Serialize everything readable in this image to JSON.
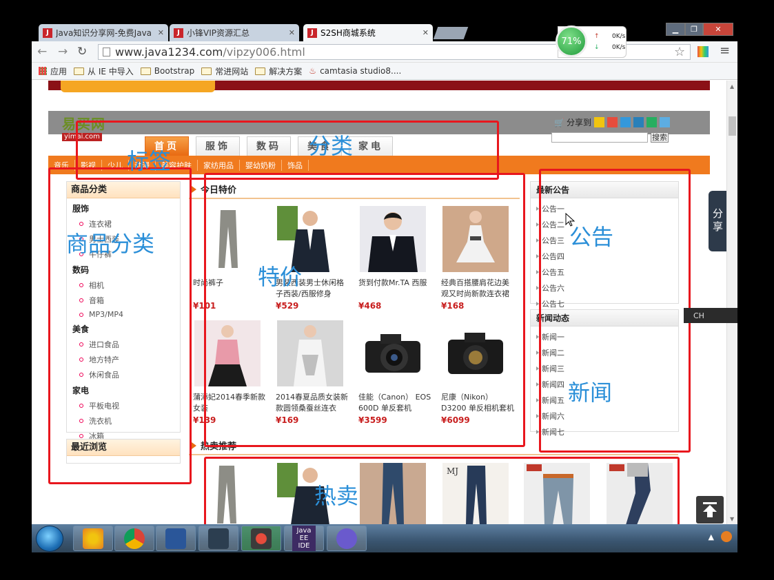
{
  "browser": {
    "tabs": [
      {
        "icon": "J",
        "title": "Java知识分享网-免费Java"
      },
      {
        "icon": "J",
        "title": "小锋VIP资源汇总"
      },
      {
        "icon": "J",
        "title": "S2SH商城系统"
      }
    ],
    "close_glyph": "✕",
    "window_buttons": [
      "▁",
      "❐",
      "✕"
    ],
    "url_host": "www.java1234.com",
    "url_path": "/vipzy006.html",
    "bookmarks": [
      "应用",
      "从 IE 中导入",
      "Bootstrap",
      "常进网站",
      "解决方案",
      "camtasia studio8...."
    ],
    "net_widget": {
      "percent": "71%",
      "up": "0K/s",
      "down": "0K/s"
    }
  },
  "site": {
    "logo_cn": "易买网",
    "logo_en": "yimai.com",
    "share_label": "分享到",
    "search_button": "搜索",
    "nav_tabs": [
      "首页",
      "服饰",
      "数码",
      "美食",
      "家电"
    ],
    "sub_nav": [
      "音乐",
      "影视",
      "少儿",
      "动漫",
      "美容护肤",
      "家纺用品",
      "婴幼奶粉",
      "饰品"
    ],
    "categories_title": "商品分类",
    "categories": [
      {
        "name": "服饰",
        "items": [
          "连衣裙",
          "男士西装",
          "牛仔裤"
        ]
      },
      {
        "name": "数码",
        "items": [
          "相机",
          "音箱",
          "MP3/MP4"
        ]
      },
      {
        "name": "美食",
        "items": [
          "进口食品",
          "地方特产",
          "休闲食品"
        ]
      },
      {
        "name": "家电",
        "items": [
          "平板电视",
          "洗衣机",
          "冰箱"
        ]
      }
    ],
    "recent_title": "最近浏览",
    "specials_title": "今日特价",
    "products": [
      {
        "name": "时尚裤子",
        "price": "¥101",
        "icon": "pants-image"
      },
      {
        "name": "男装西装男士休闲格子西装/西服修身",
        "price": "¥529",
        "icon": "suit-image"
      },
      {
        "name": "货到付款Mr.TA 西服",
        "price": "¥468",
        "icon": "suit-image"
      },
      {
        "name": "经典百搭腰肩花边美观又时尚新款连衣裙",
        "price": "¥168",
        "icon": "dress-image"
      },
      {
        "name": "蒲添妃2014春季新款女装",
        "price": "¥139",
        "icon": "dress-image"
      },
      {
        "name": "2014春夏品质女装新款圆领桑蚕丝连衣",
        "price": "¥169",
        "icon": "dress-image"
      },
      {
        "name": "佳能（Canon） EOS 600D 单反套机",
        "price": "¥3599",
        "icon": "camera-image"
      },
      {
        "name": "尼康（Nikon） D3200 单反相机套机",
        "price": "¥6099",
        "icon": "camera-image"
      }
    ],
    "hot_title": "热卖推荐",
    "notice_title": "最新公告",
    "notices": [
      "公告一",
      "公告二",
      "公告三",
      "公告四",
      "公告五",
      "公告六",
      "公告七"
    ],
    "news_title": "新闻动态",
    "news": [
      "新闻一",
      "新闻二",
      "新闻三",
      "新闻四",
      "新闻五",
      "新闻六",
      "新闻七"
    ],
    "side_share": "分享",
    "ime_label": "CH"
  },
  "annotations": {
    "tags": "标签",
    "category": "分类",
    "goods_category": "商品分类",
    "specials": "特价",
    "notice": "公告",
    "news": "新闻",
    "hot": "热卖",
    "color": "#2b8fd8",
    "box_color": "#e8161d"
  },
  "taskbar": {
    "apps": [
      "windows-explorer",
      "chrome",
      "word",
      "terminal",
      "app-red",
      "java-ee-ide",
      "eclipse"
    ],
    "java_label": "Java EE IDE"
  }
}
